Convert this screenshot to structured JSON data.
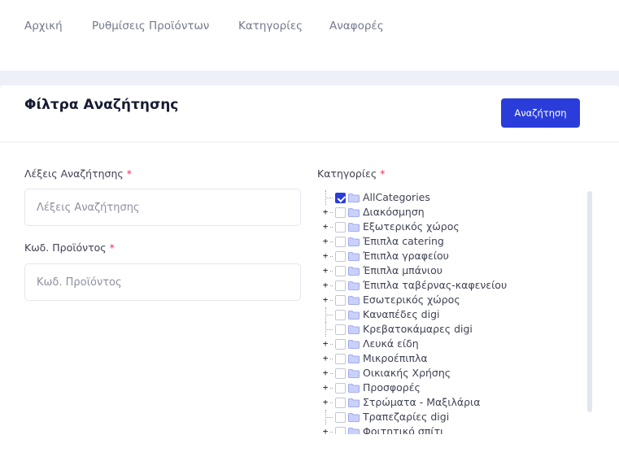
{
  "nav": {
    "items": [
      {
        "label": "Αρχική"
      },
      {
        "label": "Ρυθμίσεις Προϊόντων"
      },
      {
        "label": "Κατηγορίες"
      },
      {
        "label": "Αναφορές"
      }
    ]
  },
  "card": {
    "title": "Φίλτρα Αναζήτησης",
    "search_button_label": "Αναζήτηση"
  },
  "form": {
    "keywords": {
      "label": "Λέξεις Αναζήτησης",
      "required_mark": "*",
      "placeholder": "Λέξεις Αναζήτησης",
      "value": ""
    },
    "product_code": {
      "label": "Κωδ. Προϊόντος",
      "required_mark": "*",
      "placeholder": "Κωδ. Προϊόντος",
      "value": ""
    },
    "categories": {
      "label": "Κατηγορίες",
      "required_mark": "*"
    }
  },
  "tree": {
    "items": [
      {
        "label": "AllCategories",
        "checked": true,
        "expandable": false
      },
      {
        "label": "Διακόσμηση",
        "checked": false,
        "expandable": true
      },
      {
        "label": "Εξωτερικός χώρος",
        "checked": false,
        "expandable": true
      },
      {
        "label": "Έπιπλα catering",
        "checked": false,
        "expandable": true
      },
      {
        "label": "Έπιπλα γραφείου",
        "checked": false,
        "expandable": true
      },
      {
        "label": "Έπιπλα μπάνιου",
        "checked": false,
        "expandable": true
      },
      {
        "label": "Έπιπλα ταβέρνας-καφενείου",
        "checked": false,
        "expandable": true
      },
      {
        "label": "Εσωτερικός χώρος",
        "checked": false,
        "expandable": true
      },
      {
        "label": "Καναπέδες digi",
        "checked": false,
        "expandable": false
      },
      {
        "label": "Κρεβατοκάμαρες digi",
        "checked": false,
        "expandable": false
      },
      {
        "label": "Λευκά είδη",
        "checked": false,
        "expandable": true
      },
      {
        "label": "Μικροέπιπλα",
        "checked": false,
        "expandable": true
      },
      {
        "label": "Οικιακής Χρήσης",
        "checked": false,
        "expandable": true
      },
      {
        "label": "Προσφορές",
        "checked": false,
        "expandable": true
      },
      {
        "label": "Στρώματα - Μαξιλάρια",
        "checked": false,
        "expandable": true
      },
      {
        "label": "Τραπεζαρίες digi",
        "checked": false,
        "expandable": false
      },
      {
        "label": "Φοιτητικό σπίτι",
        "checked": false,
        "expandable": true
      }
    ],
    "expander_glyph": "+"
  },
  "colors": {
    "accent": "#2a3ddb",
    "required": "#e8305c",
    "folder": "#c9d1fb"
  }
}
